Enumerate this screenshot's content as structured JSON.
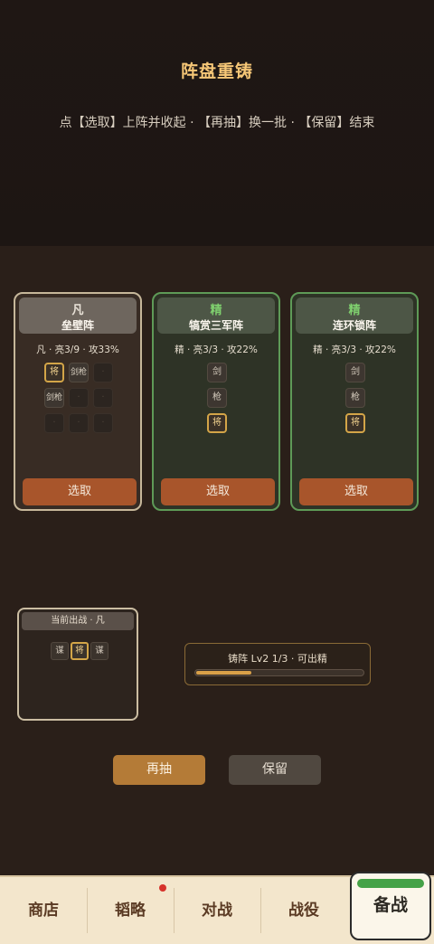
{
  "header": {
    "title": "阵盘重铸",
    "subtitle": "点【选取】上阵并收起 · 【再抽】换一批 · 【保留】结束"
  },
  "cards": [
    {
      "grade": "凡",
      "name": "垒壁阵",
      "stats": "凡 · 亮3/9 · 攻33%",
      "slots": [
        "将",
        "剑枪",
        "·",
        "剑枪",
        "·",
        "·",
        "·",
        "·",
        "·"
      ],
      "button": "选取"
    },
    {
      "grade": "精",
      "name": "犒赏三军阵",
      "stats": "精 · 亮3/3 · 攻22%",
      "slots": [
        "剑",
        "枪",
        "将"
      ],
      "button": "选取"
    },
    {
      "grade": "精",
      "name": "连环锁阵",
      "stats": "精 · 亮3/3 · 攻22%",
      "slots": [
        "剑",
        "枪",
        "将"
      ],
      "button": "选取"
    }
  ],
  "current": {
    "label": "当前出战 · 凡",
    "slots": [
      "谋",
      "将",
      "谋"
    ]
  },
  "forge": {
    "label": "铸阵 Lv2 1/3 · 可出精",
    "progress": 0.33,
    "color": "#d9a048"
  },
  "actions": {
    "redraw": "再抽",
    "keep": "保留"
  },
  "nav": {
    "items": [
      "商店",
      "韬略",
      "对战",
      "战役"
    ],
    "active": "备战",
    "badge_color": "#d6322a",
    "active_bar_color": "#45a247"
  }
}
